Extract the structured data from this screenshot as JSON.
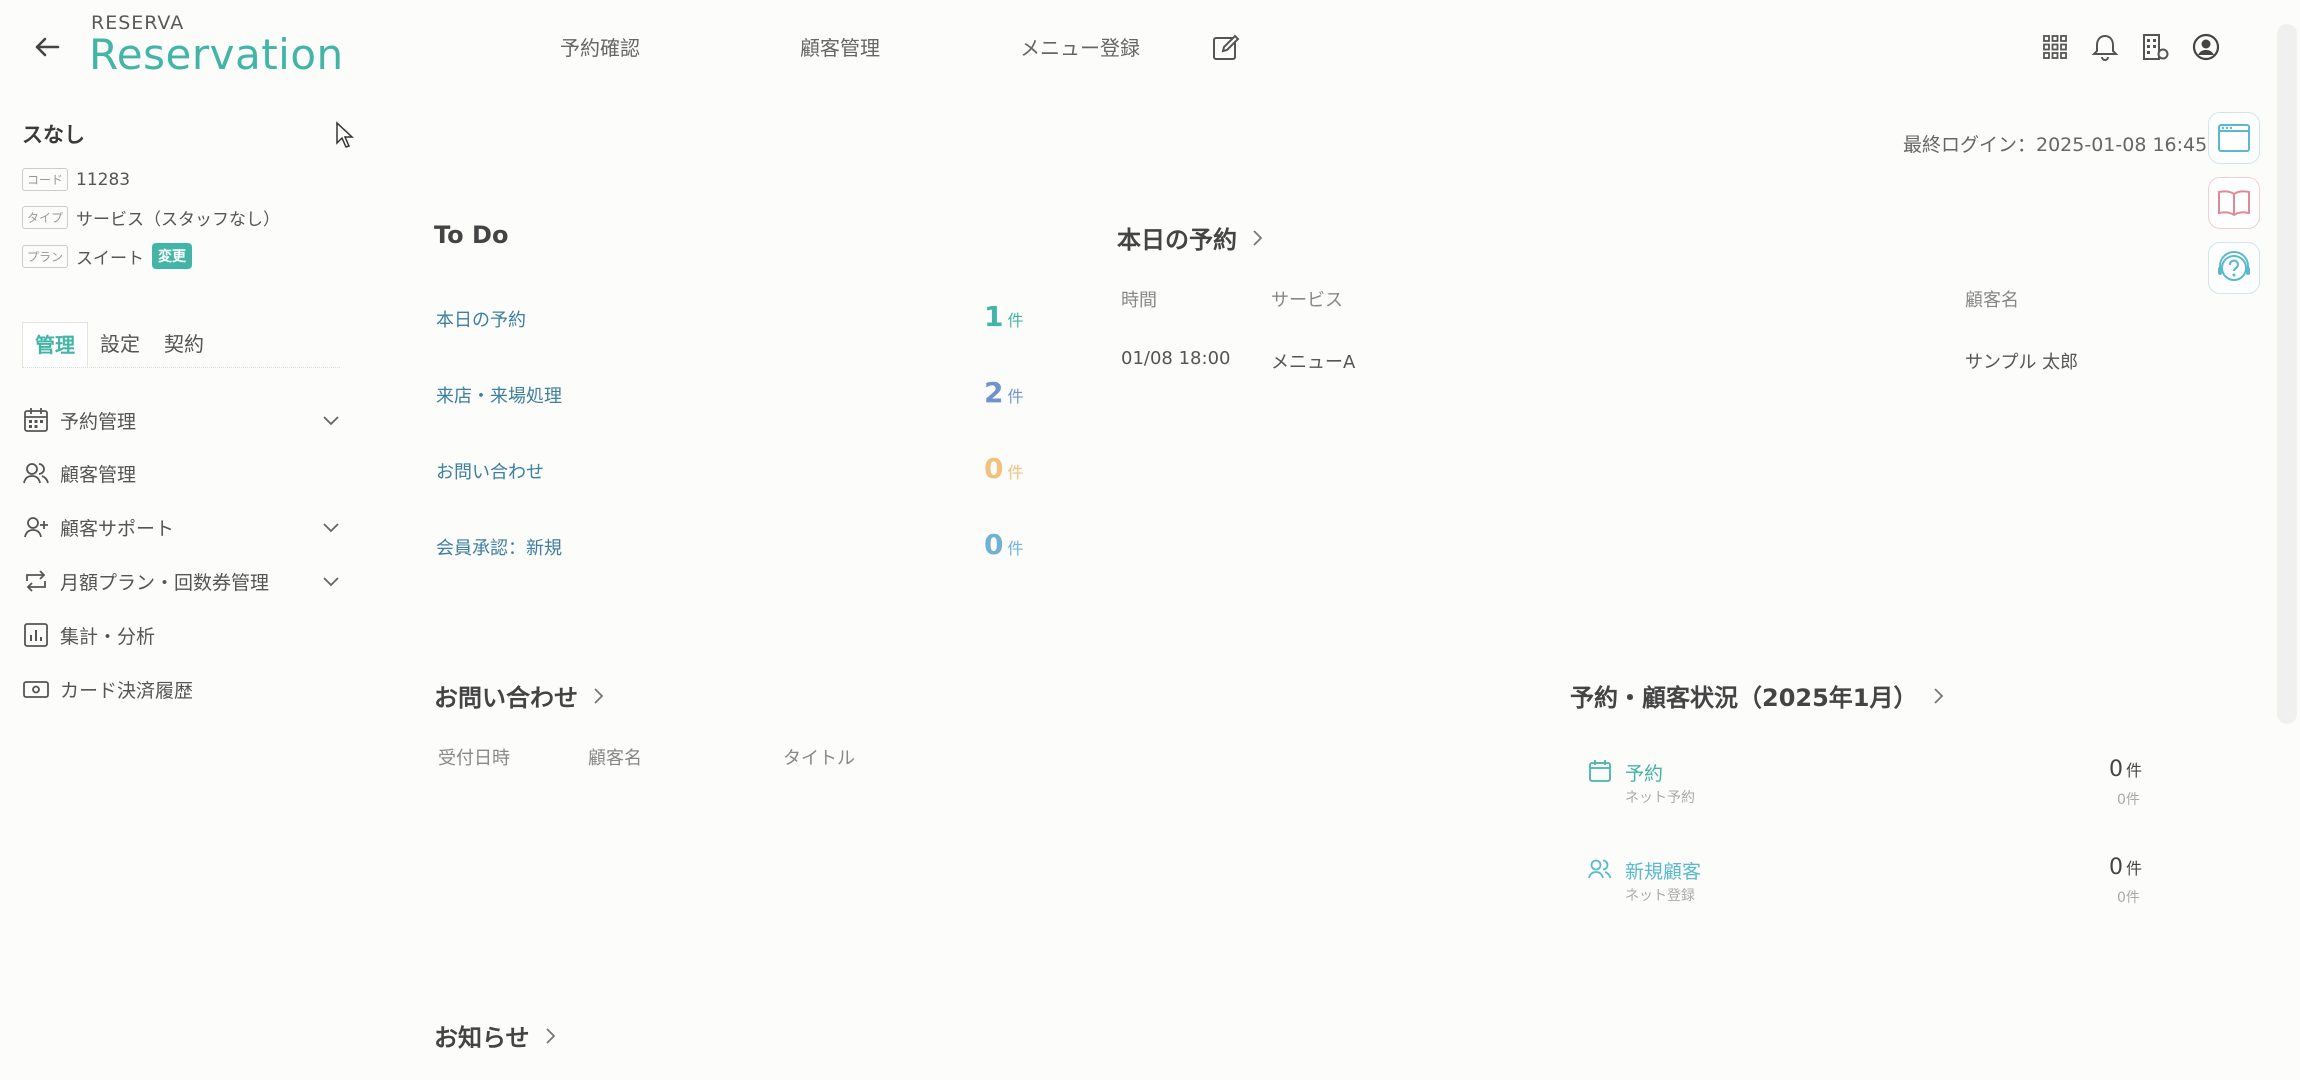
{
  "header": {
    "logo_small": "RESERVA",
    "logo_big": "Reservation",
    "nav": [
      "予約確認",
      "顧客管理",
      "メニュー登録"
    ]
  },
  "sidebar": {
    "shop_name": "スなし",
    "code_tag": "コード",
    "code_value": "11283",
    "type_tag": "タイプ",
    "type_value": "サービス（スタッフなし）",
    "plan_tag": "プラン",
    "plan_value": "スイート",
    "plan_change": "変更",
    "tabs": [
      "管理",
      "設定",
      "契約"
    ],
    "menu": [
      "予約管理",
      "顧客管理",
      "顧客サポート",
      "月額プラン・回数券管理",
      "集計・分析",
      "カード決済履歴"
    ]
  },
  "content": {
    "last_login": "最終ログイン：2025-01-08 16:45",
    "todo": {
      "title": "To Do",
      "unit": "件",
      "items": [
        {
          "label": "本日の予約",
          "count": "1",
          "color": "#43b5a7"
        },
        {
          "label": "来店・来場処理",
          "count": "2",
          "color": "#6f93cf"
        },
        {
          "label": "お問い合わせ",
          "count": "0",
          "color": "#f1c27d"
        },
        {
          "label": "会員承認：新規",
          "count": "0",
          "color": "#6fb2d6"
        }
      ]
    },
    "today": {
      "title": "本日の予約",
      "headers": [
        "時間",
        "サービス",
        "顧客名"
      ],
      "rows": [
        {
          "time": "01/08 18:00",
          "service": "メニューA",
          "customer": "サンプル 太郎"
        }
      ]
    },
    "inquiry": {
      "title": "お問い合わせ",
      "headers": [
        "受付日時",
        "顧客名",
        "タイトル"
      ]
    },
    "status": {
      "title": "予約・顧客状況（2025年1月）",
      "items": [
        {
          "label": "予約",
          "sub": "ネット予約",
          "value": "0",
          "subvalue": "0件"
        },
        {
          "label": "新規顧客",
          "sub": "ネット登録",
          "value": "0",
          "subvalue": "0件"
        }
      ],
      "unit": "件"
    },
    "news": {
      "title": "お知らせ"
    }
  }
}
